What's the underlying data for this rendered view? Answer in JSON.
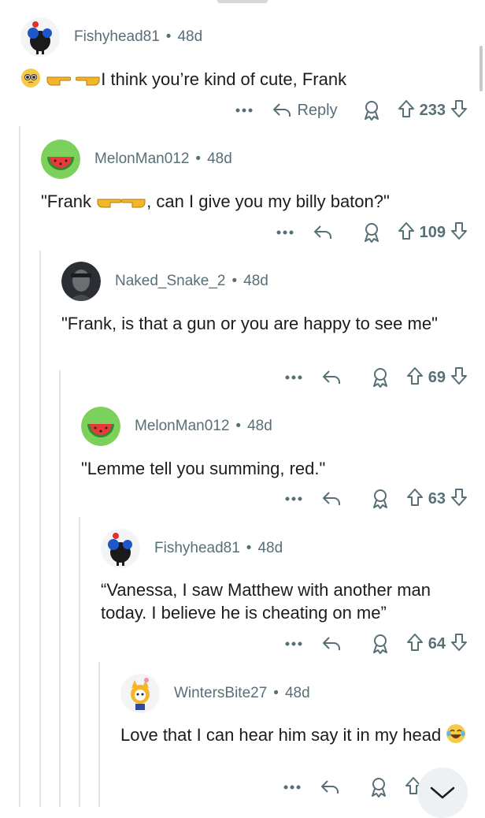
{
  "comments": [
    {
      "username": "Fishyhead81",
      "age": "48d",
      "text": "I think you’re kind of cute, Frank",
      "score": "233",
      "reply_label": "Reply"
    },
    {
      "username": "MelonMan012",
      "age": "48d",
      "text_before": "\"Frank ",
      "text_after": ", can I give you my billy baton?\"",
      "score": "109"
    },
    {
      "username": "Naked_Snake_2",
      "age": "48d",
      "text": "\"Frank, is that a gun or you are happy to see me\"",
      "score": "69"
    },
    {
      "username": "MelonMan012",
      "age": "48d",
      "text": "\"Lemme tell you summing, red.\"",
      "score": "63"
    },
    {
      "username": "Fishyhead81",
      "age": "48d",
      "text": "“Vanessa, I saw Matthew with another man today. I believe he is cheating on me”",
      "score": "64"
    },
    {
      "username": "WintersBite27",
      "age": "48d",
      "text": "Love that I can hear him say it in my head",
      "score": ""
    }
  ],
  "separator": "•",
  "colors": {
    "meta": "#576f76",
    "thread_line": "#e3e3e3",
    "text": "#1c1c1c"
  }
}
